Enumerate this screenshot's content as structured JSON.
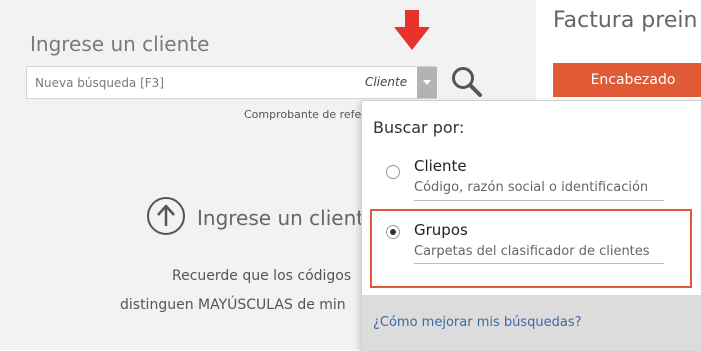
{
  "left": {
    "title": "Ingrese un cliente",
    "search": {
      "placeholder": "Nueva búsqueda [F3]",
      "mode_label": "Cliente"
    },
    "reference_text": "Comprobante de refe",
    "upload": {
      "label": "Ingrese un client"
    },
    "reminder": {
      "line1": "Recuerde que los códigos",
      "line2": "distinguen MAYÚSCULAS de min"
    }
  },
  "right": {
    "title": "Factura prein",
    "header_button": "Encabezado"
  },
  "dropdown": {
    "title": "Buscar por:",
    "options": [
      {
        "label": "Cliente",
        "desc": "Código, razón social o identificación",
        "selected": false
      },
      {
        "label": "Grupos",
        "desc": "Carpetas del clasificador de clientes",
        "selected": true
      }
    ],
    "help_link": "¿Cómo mejorar mis búsquedas?"
  },
  "colors": {
    "accent": "#e05a35",
    "arrow": "#e8322c",
    "link": "#3c6aa6"
  },
  "icons": [
    "search-icon",
    "down-arrow-icon",
    "upload-icon",
    "chevron-down-icon"
  ]
}
